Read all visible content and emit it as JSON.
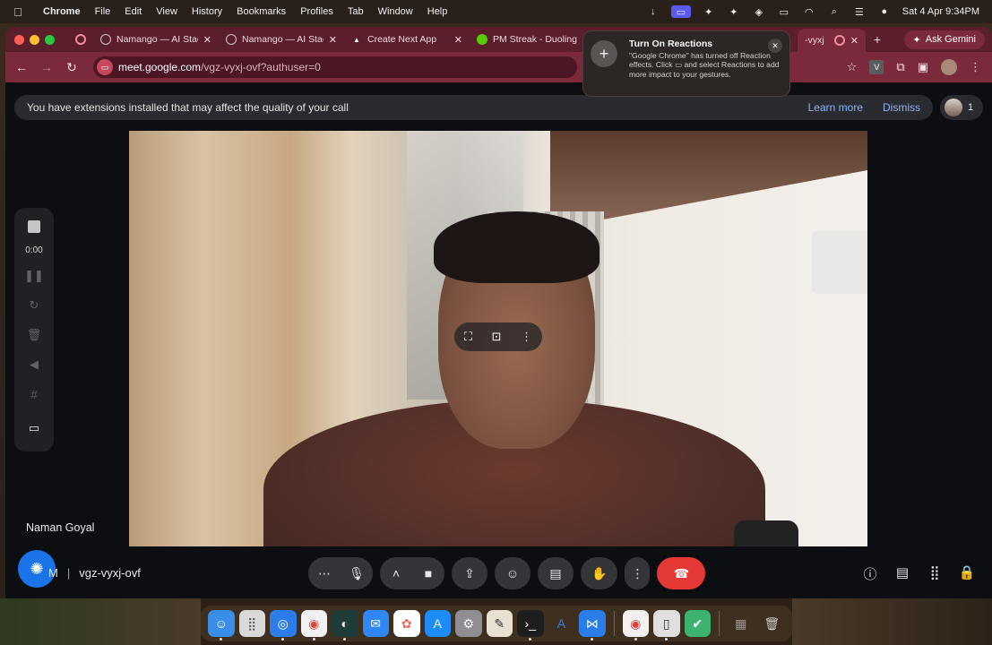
{
  "menubar": {
    "app": "Chrome",
    "items": [
      "File",
      "Edit",
      "View",
      "History",
      "Bookmarks",
      "Profiles",
      "Tab",
      "Window",
      "Help"
    ],
    "clock": "Sat 4 Apr  9:34PM"
  },
  "tabs": [
    {
      "label": "Namango — AI Stac"
    },
    {
      "label": "Namango — AI Stac"
    },
    {
      "label": "Create Next App"
    },
    {
      "label": "PM Streak - Duoling"
    },
    {
      "label": "-vyxj"
    }
  ],
  "gemini_label": "Ask Gemini",
  "omnibox": {
    "host": "meet.google.com",
    "path": "/vgz-vyxj-ovf?authuser=0"
  },
  "toolbar_badge": "V",
  "banner": {
    "text": "You have extensions installed that may affect the quality of your call",
    "learn_more": "Learn more",
    "dismiss": "Dismiss"
  },
  "participants_count": "1",
  "recording": {
    "time": "0:00"
  },
  "participant_name": "Naman Goyal",
  "meet_code": {
    "prefix": "M",
    "code": "vgz-vyxj-ovf"
  },
  "notification": {
    "title": "Turn On Reactions",
    "body": "\"Google Chrome\" has turned off Reaction effects. Click ▭ and select Reactions to add more impact to your gestures."
  },
  "colors": {
    "accent_blue": "#1a73e8",
    "end_call": "#e53935",
    "tab_bar": "#5b1e2b",
    "link": "#8ab4f8"
  }
}
